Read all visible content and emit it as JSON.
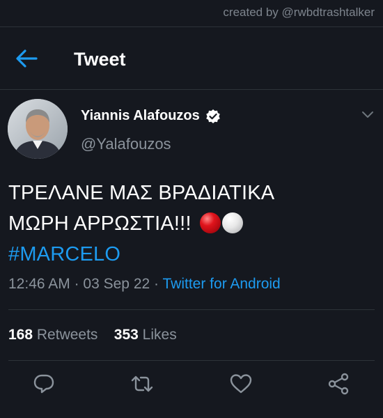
{
  "watermark": "created by @rwbdtrashtalker",
  "header": {
    "title": "Tweet"
  },
  "tweet": {
    "display_name": "Yiannis Alafouzos",
    "handle": "@Yalafouzos",
    "line1": "ΤΡΕΛΑΝΕ ΜΑΣ ΒΡΑΔΙΑΤΙΚΑ",
    "line2": "ΜΩΡΗ ΑΡΡΩΣΤΙΑ!!!",
    "emoji": [
      "red-circle",
      "white-circle"
    ],
    "hashtag": "#MARCELO",
    "time": "12:46 AM",
    "date": "03 Sep 22",
    "source": "Twitter for Android",
    "retweets_count": "168",
    "retweets_label": "Retweets",
    "likes_count": "353",
    "likes_label": "Likes"
  },
  "icons": [
    "back-arrow-icon",
    "verified-badge-icon",
    "chevron-down-icon",
    "reply-icon",
    "retweet-icon",
    "like-icon",
    "share-icon"
  ],
  "colors": {
    "background": "#15181f",
    "accent": "#1d9bf0",
    "muted": "#8b939c"
  }
}
